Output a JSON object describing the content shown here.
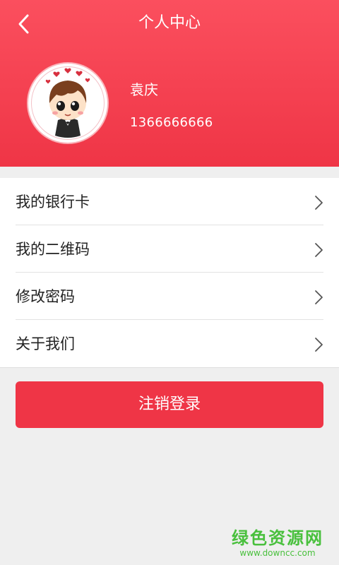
{
  "header": {
    "title": "个人中心",
    "background_color": "#ef3546",
    "back_icon": "chevron-left-icon"
  },
  "user": {
    "name": "袁庆",
    "phone": "1366666666",
    "avatar": "cartoon-avatar"
  },
  "menu": {
    "items": [
      {
        "label": "我的银行卡",
        "icon": "chevron-right-icon"
      },
      {
        "label": "我的二维码",
        "icon": "chevron-right-icon"
      },
      {
        "label": "修改密码",
        "icon": "chevron-right-icon"
      },
      {
        "label": "关于我们",
        "icon": "chevron-right-icon"
      }
    ]
  },
  "logout": {
    "label": "注销登录",
    "color": "#ef3546"
  },
  "watermark": {
    "title": "绿色资源网",
    "url": "www.downcc.com",
    "color": "#49c03d"
  }
}
